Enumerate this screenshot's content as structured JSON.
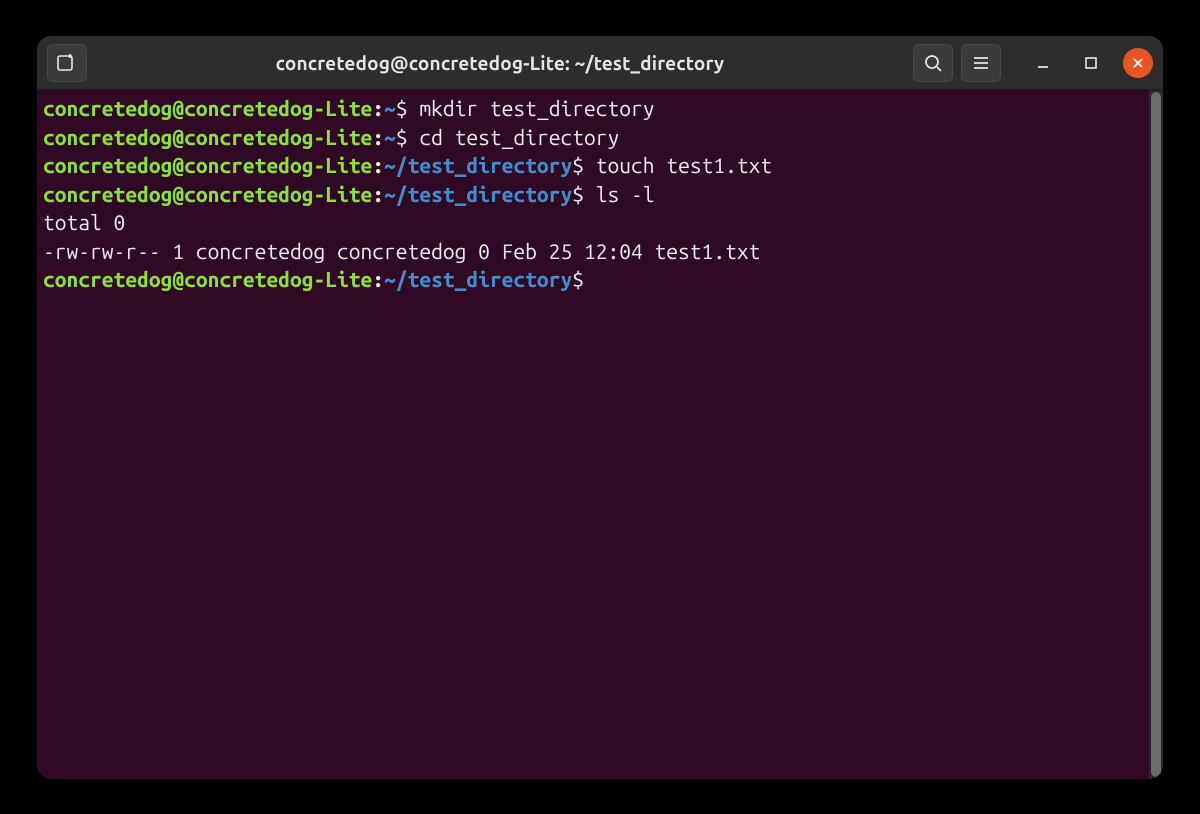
{
  "window": {
    "title": "concretedog@concretedog-Lite: ~/test_directory"
  },
  "lines": [
    {
      "user": "concretedog@concretedog-Lite",
      "sep": ":",
      "path": "~",
      "prompt": "$",
      "cmd": " mkdir test_directory"
    },
    {
      "user": "concretedog@concretedog-Lite",
      "sep": ":",
      "path": "~",
      "prompt": "$",
      "cmd": " cd test_directory"
    },
    {
      "user": "concretedog@concretedog-Lite",
      "sep": ":",
      "path": "~/test_directory",
      "prompt": "$",
      "cmd": " touch test1.txt"
    },
    {
      "user": "concretedog@concretedog-Lite",
      "sep": ":",
      "path": "~/test_directory",
      "prompt": "$",
      "cmd": " ls -l"
    },
    {
      "out": "total 0"
    },
    {
      "out": "-rw-rw-r-- 1 concretedog concretedog 0 Feb 25 12:04 test1.txt"
    },
    {
      "user": "concretedog@concretedog-Lite",
      "sep": ":",
      "path": "~/test_directory",
      "prompt": "$",
      "cmd": " ",
      "cursor": true
    }
  ]
}
